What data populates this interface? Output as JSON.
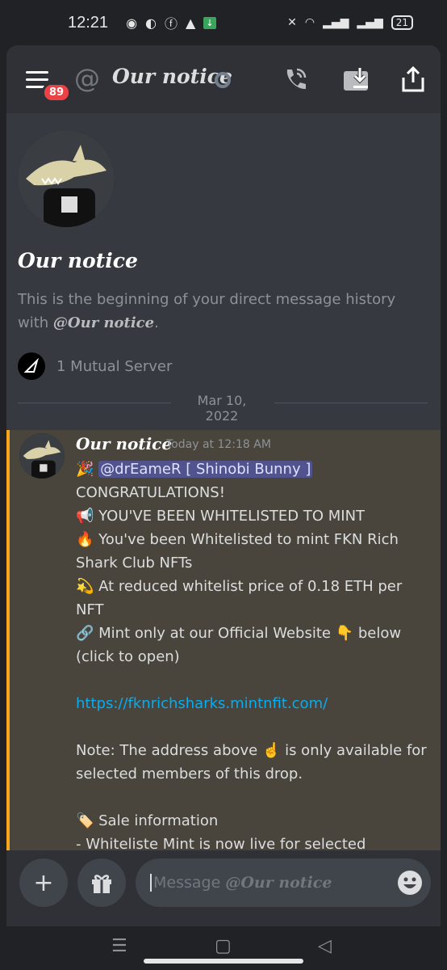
{
  "status_bar": {
    "time": "12:21",
    "battery": "21"
  },
  "header": {
    "badge": "89",
    "title": "Our notice"
  },
  "intro": {
    "title": "Our notice",
    "text_prefix": "This is the beginning of your direct message history with ",
    "text_user": "@Our notice",
    "text_suffix": ".",
    "mutual_servers": "1 Mutual Server"
  },
  "divider": {
    "date": "Mar 10, 2022"
  },
  "message": {
    "author": "Our notice",
    "time": "Today at 12:18 AM",
    "line1_emoji": "🎉",
    "mention": "@drEameR [ Shinobi Bunny ]",
    "line2": "CONGRATULATIONS!",
    "line3": "📢 YOU'VE BEEN WHITELISTED TO MINT",
    "line4": "🔥 You've been Whitelisted to mint FKN Rich Shark Club NFTs",
    "line5": "💫 At reduced whitelist price of 0.18 ETH per NFT",
    "line6": "🔗 Mint only at our Official Website 👇 below (click to open)",
    "link": "https://fknrichsharks.mintnfit.com/",
    "note": "Note: The address above ☝️ is only available for selected members of this drop.",
    "sale_heading": "🏷️ Sale information",
    "sale_line": "- Whiteliste Mint is now live for selected memebers"
  },
  "composer": {
    "placeholder_prefix": "Message ",
    "placeholder_user": "@Our notice"
  }
}
